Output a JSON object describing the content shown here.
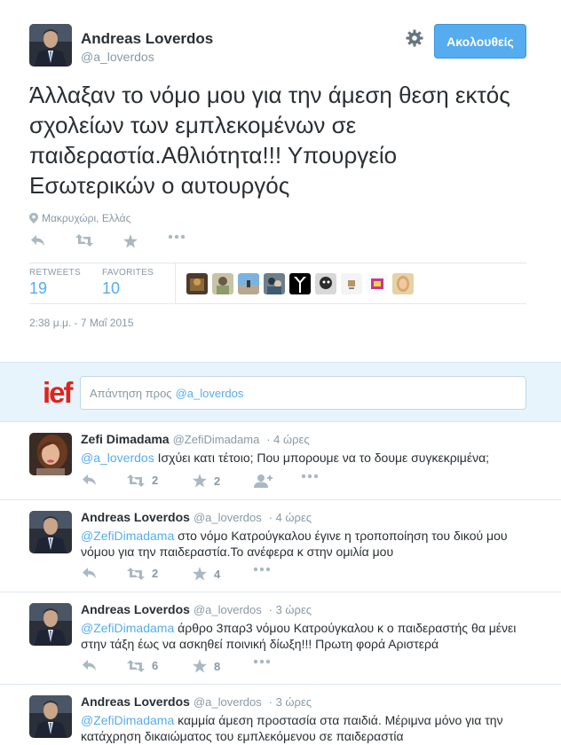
{
  "tweet": {
    "author_name": "Andreas Loverdos",
    "author_handle": "@a_loverdos",
    "follow_label": "Ακολουθείς",
    "text": "Άλλαξαν το νόμο μου για την άμεση θεση εκτός σχολείων των εμπλεκομένων σε παιδεραστία.Αθλιότητα!!! Υπουργείο Εσωτερικών ο αυτουργός",
    "location": "Μακρυχώρι, Ελλάς",
    "retweets_label": "RETWEETS",
    "retweets": "19",
    "favorites_label": "FAVORITES",
    "favorites": "10",
    "timestamp": "2:38 μ.μ. - 7 Μαΐ 2015"
  },
  "reply_box": {
    "logo": "ief",
    "placeholder": "Απάντηση προς",
    "mention": "@a_loverdos"
  },
  "replies": [
    {
      "name": "Zefi Dimadama",
      "handle": "@ZefiDimadama",
      "time": "· 4 ώρες",
      "mention": "@a_loverdos",
      "text": " Ισχύει κατι τέτοιο; Που μπορουμε να το δουμε συγκεκριμένα;",
      "retweets": "2",
      "favorites": "2"
    },
    {
      "name": "Andreas Loverdos",
      "handle": "@a_loverdos",
      "time": "· 4 ώρες",
      "mention": "@ZefiDimadama",
      "text": " στο νόμο Κατρούγκαλου έγινε η τροποποίηση του δικού μου νόμου για την παιδεραστία.Το ανέφερα κ στην ομιλία μου",
      "retweets": "2",
      "favorites": "4"
    },
    {
      "name": "Andreas Loverdos",
      "handle": "@a_loverdos",
      "time": "· 3 ώρες",
      "mention": "@ZefiDimadama",
      "text": " άρθρο 3παρ3 νόμου Κατρούγκαλου κ ο παιδεραστής θα μένει στην τάξη έως να ασκηθεί ποινική δίωξη!!! Πρωτη φορά Αριστερά",
      "retweets": "6",
      "favorites": "8"
    },
    {
      "name": "Andreas Loverdos",
      "handle": "@a_loverdos",
      "time": "· 3 ώρες",
      "mention": "@ZefiDimadama",
      "text": " καμμία άμεση  προστασία στα παιδιά. Μέριμνα μόνο για την κατάχρηση δικαιώματος του εμπλεκόμενου σε παιδεραστία"
    }
  ]
}
